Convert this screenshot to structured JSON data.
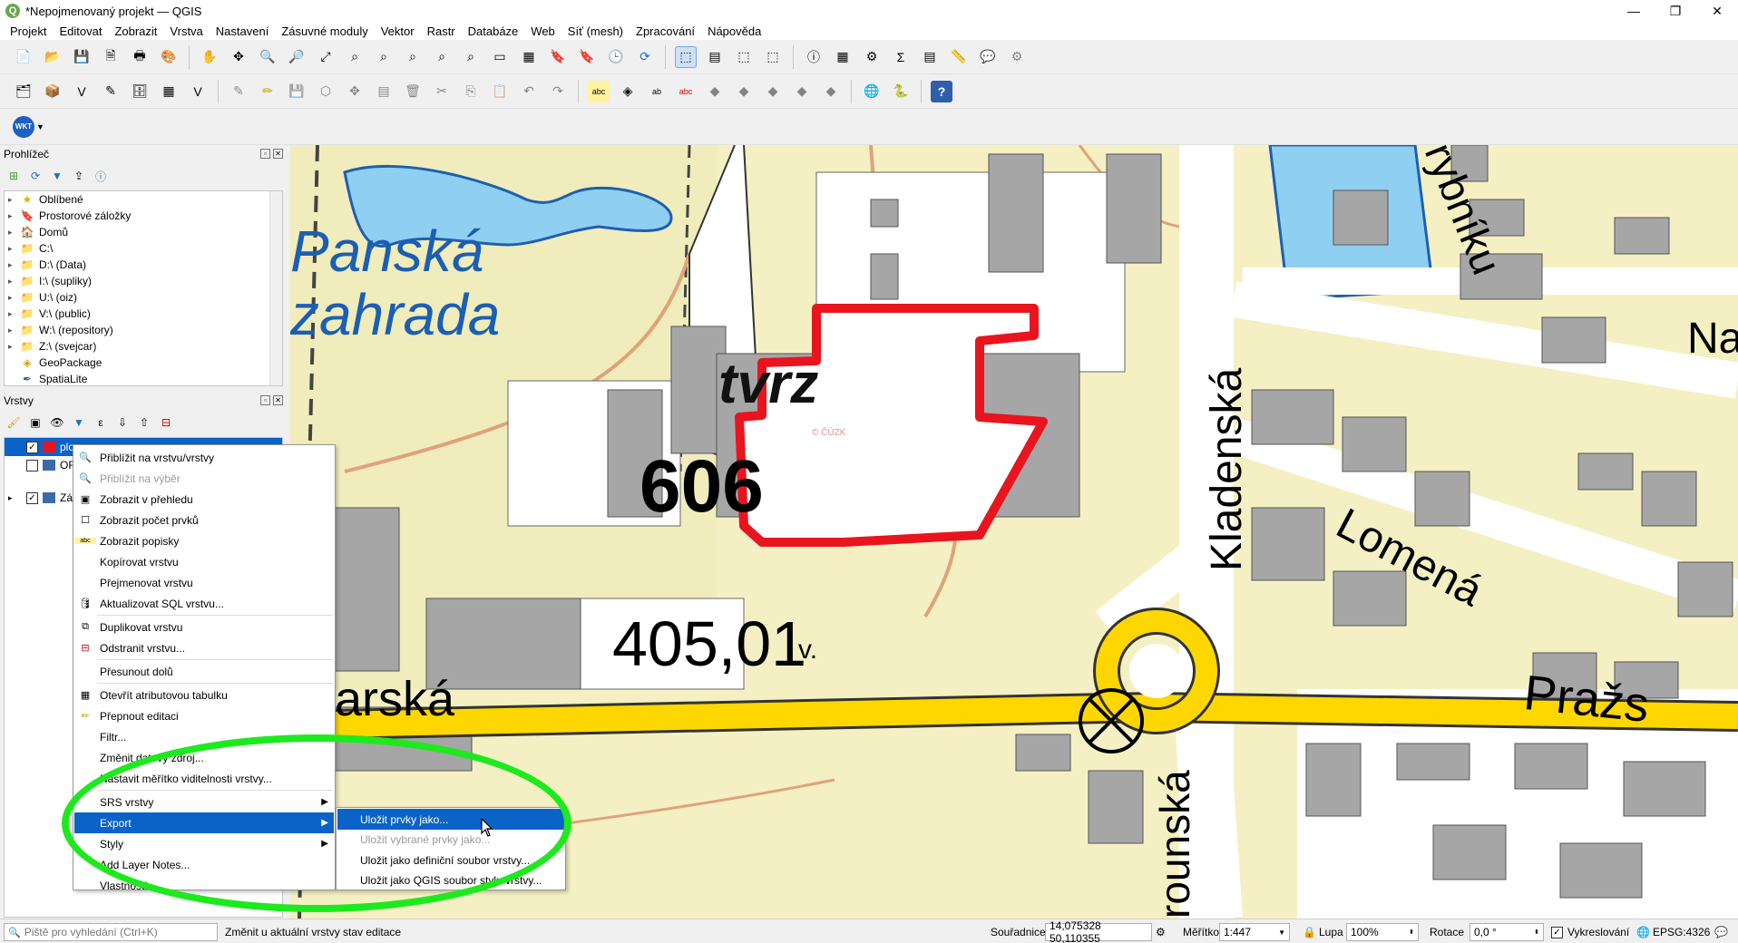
{
  "window": {
    "title": "*Nepojmenovaný projekt — QGIS",
    "minimize": "—",
    "maximize": "❐",
    "close": "✕"
  },
  "menubar": [
    "Projekt",
    "Editovat",
    "Zobrazit",
    "Vrstva",
    "Nastavení",
    "Zásuvné moduly",
    "Vektor",
    "Rastr",
    "Databáze",
    "Web",
    "Síť (mesh)",
    "Zpracování",
    "Nápověda"
  ],
  "toolbar_wkt": {
    "label": "WKT"
  },
  "browser_panel": {
    "title": "Prohlížeč",
    "items": [
      {
        "label": "Oblíbené",
        "icon": "star-icon"
      },
      {
        "label": "Prostorové záložky",
        "icon": "bookmark-icon"
      },
      {
        "label": "Domů",
        "icon": "home-folder-icon"
      },
      {
        "label": "C:\\",
        "icon": "folder-icon"
      },
      {
        "label": "D:\\ (Data)",
        "icon": "folder-icon"
      },
      {
        "label": "I:\\ (supliky)",
        "icon": "folder-icon"
      },
      {
        "label": "U:\\ (oiz)",
        "icon": "folder-icon"
      },
      {
        "label": "V:\\ (public)",
        "icon": "folder-icon"
      },
      {
        "label": "W:\\ (repository)",
        "icon": "folder-icon"
      },
      {
        "label": "Z:\\ (svejcar)",
        "icon": "folder-icon"
      },
      {
        "label": "GeoPackage",
        "icon": "geopackage-icon"
      },
      {
        "label": "SpatiaLite",
        "icon": "spatialite-icon"
      }
    ]
  },
  "layers_panel": {
    "title": "Vrstvy",
    "layers": [
      {
        "label": "plo",
        "checked": true,
        "selected": true
      },
      {
        "label": "OR",
        "checked": false,
        "selected": false
      },
      {
        "label": "Zá",
        "checked": true,
        "selected": false
      }
    ]
  },
  "map": {
    "labels": {
      "park": [
        "Panská",
        "zahrada"
      ],
      "building": "tvrz",
      "number": "606",
      "parcel": "405,01",
      "street_kladenska": "Kladenská",
      "street_lomena": "Lomená",
      "street_prazska": "Pražs",
      "street_hlovarska": "lovarská",
      "street_rybniku": "rybníku",
      "street_na": "Na",
      "street_rounska": "rounská",
      "copyright": "© ČÚZK",
      "letter_v": "v."
    },
    "colors": {
      "background": "#f4f0c4",
      "building": "#a6a6a6",
      "water": "#8fd0f2",
      "road_main": "#ffd700",
      "outline_red": "#e8141e",
      "text_blue": "#1a5fb4"
    }
  },
  "context_menu": {
    "items": [
      {
        "label": "Přiblížit na vrstvu/vrstvy",
        "icon": "zoom-layer-icon",
        "disabled": false
      },
      {
        "label": "Přiblížit na výběr",
        "icon": "zoom-selection-icon",
        "disabled": true
      },
      {
        "label": "Zobrazit v přehledu",
        "icon": "overview-icon",
        "disabled": false
      },
      {
        "label": "Zobrazit počet prvků",
        "icon": "checkbox-icon",
        "disabled": false
      },
      {
        "label": "Zobrazit popisky",
        "icon": "labels-icon",
        "disabled": false
      },
      {
        "label": "Kopírovat vrstvu",
        "icon": "",
        "disabled": false
      },
      {
        "label": "Přejmenovat vrstvu",
        "icon": "",
        "disabled": false
      },
      {
        "label": "Aktualizovat SQL vrstvu...",
        "icon": "database-icon",
        "disabled": false
      },
      {
        "label": "Duplikovat vrstvu",
        "icon": "duplicate-icon",
        "disabled": false
      },
      {
        "label": "Odstranit vrstvu...",
        "icon": "remove-layer-icon",
        "disabled": false
      },
      {
        "label": "Přesunout dolů",
        "icon": "",
        "disabled": false
      },
      {
        "label": "Otevřít atributovou tabulku",
        "icon": "table-icon",
        "disabled": false
      },
      {
        "label": "Přepnout editaci",
        "icon": "pencil-icon",
        "disabled": false
      },
      {
        "label": "Filtr...",
        "icon": "",
        "disabled": false
      },
      {
        "label": "Změnit datový zdroj...",
        "icon": "",
        "disabled": false
      },
      {
        "label": "Nastavit měřítko viditelnosti vrstvy...",
        "icon": "",
        "disabled": false
      },
      {
        "label": "SRS vrstvy",
        "icon": "",
        "disabled": false,
        "submenu": true
      },
      {
        "label": "Export",
        "icon": "",
        "disabled": false,
        "submenu": true,
        "highlighted": true
      },
      {
        "label": "Styly",
        "icon": "",
        "disabled": false,
        "submenu": true
      },
      {
        "label": "Add Layer Notes...",
        "icon": "",
        "disabled": false
      },
      {
        "label": "Vlastnosti...",
        "icon": "",
        "disabled": false
      }
    ]
  },
  "export_submenu": {
    "items": [
      {
        "label": "Uložit prvky jako...",
        "disabled": false,
        "highlighted": true
      },
      {
        "label": "Uložit vybrané prvky jako...",
        "disabled": true,
        "highlighted": false
      },
      {
        "label": "Uložit jako definiční soubor vrstvy...",
        "disabled": false,
        "highlighted": false
      },
      {
        "label": "Uložit jako QGIS soubor stylu vrstvy...",
        "disabled": false,
        "highlighted": false
      }
    ]
  },
  "statusbar": {
    "search_placeholder": "Piště pro vyhledání (Ctrl+K)",
    "message": "Změnit u aktuální vrstvy stav editace",
    "coord_label": "Souřadnice",
    "coord_value": "14,075328 50,110355",
    "scale_label": "Měřítko",
    "scale_value": "1:447",
    "magnifier_label": "Lupa",
    "magnifier_value": "100%",
    "rotation_label": "Rotace",
    "rotation_value": "0,0 °",
    "render_label": "Vykreslování",
    "epsg": "EPSG:4326"
  }
}
